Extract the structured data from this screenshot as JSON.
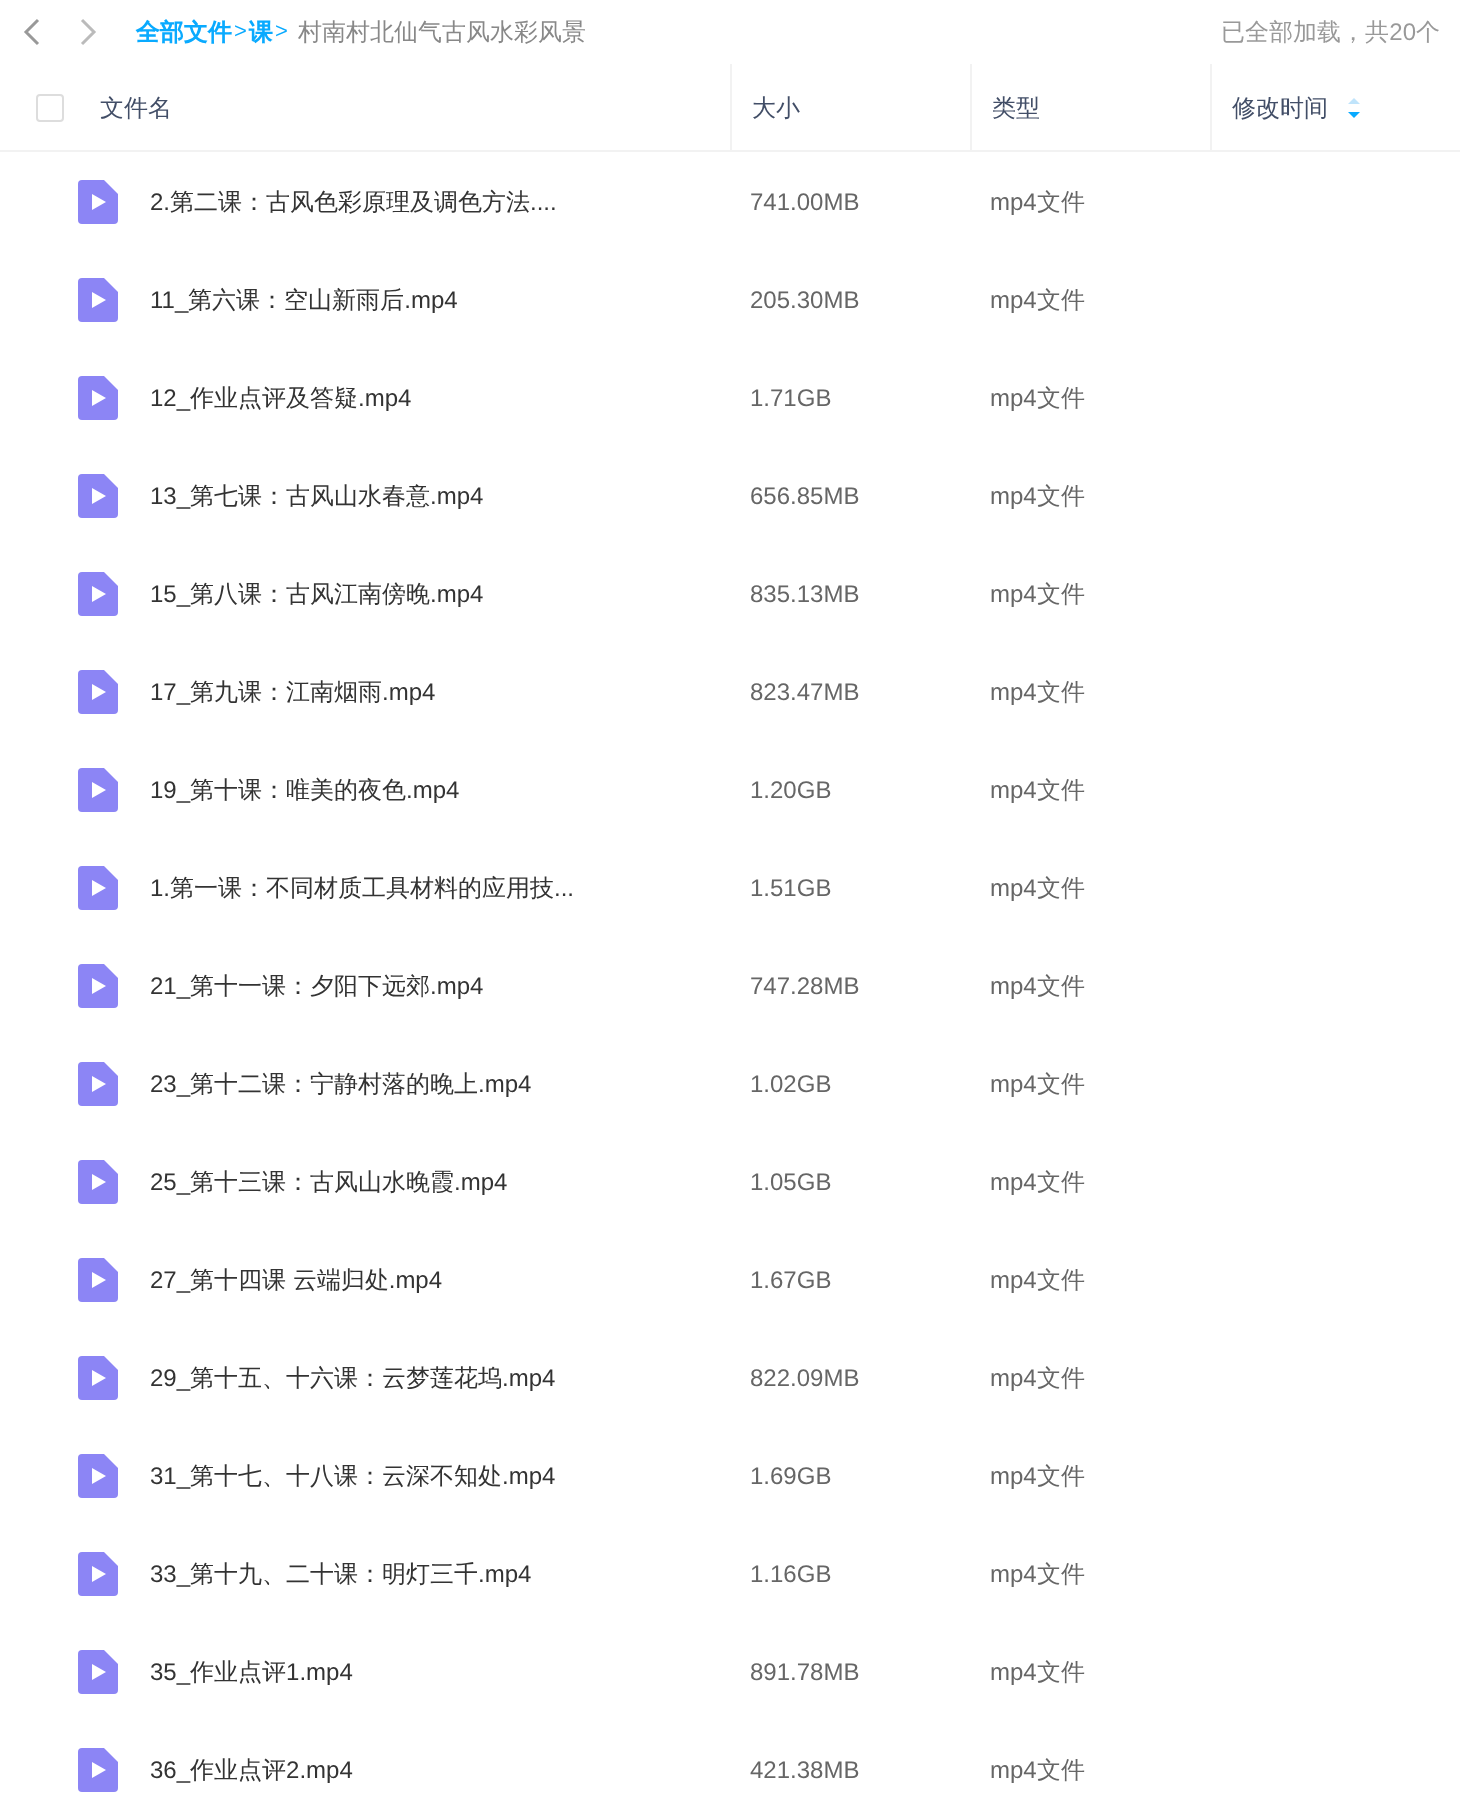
{
  "breadcrumb": [
    {
      "label": "全部文件",
      "kind": "link"
    },
    {
      "label": ">",
      "kind": "sep"
    },
    {
      "label": "课",
      "kind": "link"
    },
    {
      "label": ">",
      "kind": "sep"
    },
    {
      "label": "村南村北仙气古风水彩风景",
      "kind": "current"
    }
  ],
  "load_status": "已全部加载，共20个",
  "table": {
    "select_all": {
      "checked": false
    },
    "columns": [
      {
        "label": "文件名",
        "sorted": false
      },
      {
        "label": "大小",
        "sorted": false
      },
      {
        "label": "类型",
        "sorted": false
      },
      {
        "label": "修改时间",
        "sorted": true
      }
    ],
    "rows": [
      {
        "name": "2.第二课：古风色彩原理及调色方法....",
        "size": "741.00MB",
        "type": "mp4文件"
      },
      {
        "name": "11_第六课：空山新雨后.mp4",
        "size": "205.30MB",
        "type": "mp4文件"
      },
      {
        "name": "12_作业点评及答疑.mp4",
        "size": "1.71GB",
        "type": "mp4文件"
      },
      {
        "name": "13_第七课：古风山水春意.mp4",
        "size": "656.85MB",
        "type": "mp4文件"
      },
      {
        "name": "15_第八课：古风江南傍晚.mp4",
        "size": "835.13MB",
        "type": "mp4文件"
      },
      {
        "name": "17_第九课：江南烟雨.mp4",
        "size": "823.47MB",
        "type": "mp4文件"
      },
      {
        "name": "19_第十课：唯美的夜色.mp4",
        "size": "1.20GB",
        "type": "mp4文件"
      },
      {
        "name": "1.第一课：不同材质工具材料的应用技...",
        "size": "1.51GB",
        "type": "mp4文件"
      },
      {
        "name": "21_第十一课：夕阳下远郊.mp4",
        "size": "747.28MB",
        "type": "mp4文件"
      },
      {
        "name": "23_第十二课：宁静村落的晚上.mp4",
        "size": "1.02GB",
        "type": "mp4文件"
      },
      {
        "name": "25_第十三课：古风山水晚霞.mp4",
        "size": "1.05GB",
        "type": "mp4文件"
      },
      {
        "name": "27_第十四课 云端归处.mp4",
        "size": "1.67GB",
        "type": "mp4文件"
      },
      {
        "name": "29_第十五、十六课：云梦莲花坞.mp4",
        "size": "822.09MB",
        "type": "mp4文件"
      },
      {
        "name": "31_第十七、十八课：云深不知处.mp4",
        "size": "1.69GB",
        "type": "mp4文件"
      },
      {
        "name": "33_第十九、二十课：明灯三千.mp4",
        "size": "1.16GB",
        "type": "mp4文件"
      },
      {
        "name": "35_作业点评1.mp4",
        "size": "891.78MB",
        "type": "mp4文件"
      },
      {
        "name": "36_作业点评2.mp4",
        "size": "421.38MB",
        "type": "mp4文件"
      }
    ]
  }
}
